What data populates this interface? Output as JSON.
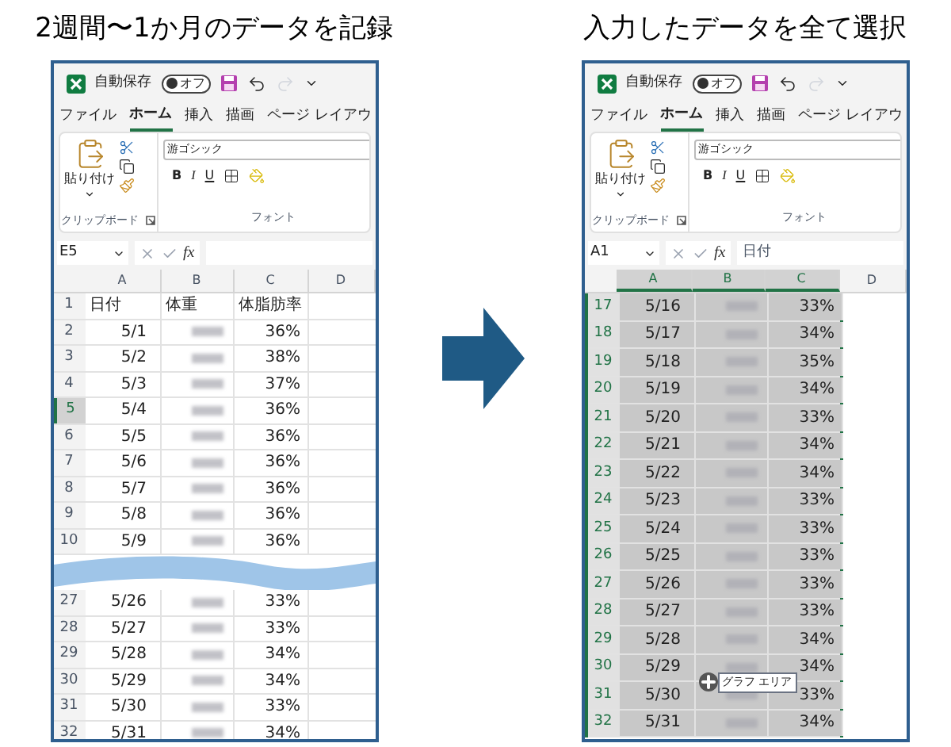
{
  "panels": [
    {
      "heading": "2週間〜1か月のデータを記録",
      "autosave_label": "自動保存",
      "autosave_on": false,
      "autosave_state": "オフ",
      "tabs": [
        {
          "label": "ファイル",
          "selected": false
        },
        {
          "label": "ホーム",
          "selected": true
        },
        {
          "label": "挿入",
          "selected": false
        },
        {
          "label": "描画",
          "selected": false
        },
        {
          "label": "ページ レイアウ",
          "selected": false
        }
      ],
      "paste_label": "貼り付け",
      "font_name": "游ゴシック",
      "format_buttons": [
        "B",
        "I",
        "U"
      ],
      "group_labels": [
        "クリップボード",
        "フォント"
      ],
      "name_box": "E5",
      "fx": "fx",
      "range_selected": false,
      "columns": [
        {
          "label": "A",
          "selected": false
        },
        {
          "label": "B",
          "selected": false
        },
        {
          "label": "C",
          "selected": false
        },
        {
          "label": "D",
          "selected": false
        }
      ],
      "row_groups": [
        {
          "rows": [
            {
              "kind": "header",
              "number": "1",
              "labels": [
                "日付",
                "体重",
                "体脂肪率"
              ],
              "selected": false
            },
            {
              "kind": "data",
              "number": "2",
              "date": "5/1",
              "percent": "36%",
              "selected": false
            },
            {
              "kind": "data",
              "number": "3",
              "date": "5/2",
              "percent": "38%",
              "selected": false
            },
            {
              "kind": "data",
              "number": "4",
              "date": "5/3",
              "percent": "37%",
              "selected": false
            },
            {
              "kind": "data",
              "number": "5",
              "date": "5/4",
              "percent": "36%",
              "selected": true
            },
            {
              "kind": "data",
              "number": "6",
              "date": "5/5",
              "percent": "36%",
              "selected": false
            },
            {
              "kind": "data",
              "number": "7",
              "date": "5/6",
              "percent": "36%",
              "selected": false
            },
            {
              "kind": "data",
              "number": "8",
              "date": "5/7",
              "percent": "36%",
              "selected": false
            },
            {
              "kind": "data",
              "number": "9",
              "date": "5/8",
              "percent": "36%",
              "selected": false
            },
            {
              "kind": "data",
              "number": "10",
              "date": "5/9",
              "percent": "36%",
              "selected": false
            }
          ]
        },
        {
          "rows": [
            {
              "kind": "data",
              "number": "27",
              "date": "5/26",
              "percent": "33%",
              "selected": false
            },
            {
              "kind": "data",
              "number": "28",
              "date": "5/27",
              "percent": "33%",
              "selected": false
            },
            {
              "kind": "data",
              "number": "29",
              "date": "5/28",
              "percent": "34%",
              "selected": false
            },
            {
              "kind": "data",
              "number": "30",
              "date": "5/29",
              "percent": "34%",
              "selected": false
            },
            {
              "kind": "data",
              "number": "31",
              "date": "5/30",
              "percent": "33%",
              "selected": false
            },
            {
              "kind": "data",
              "number": "32",
              "date": "5/31",
              "percent": "34%",
              "selected": false
            }
          ]
        }
      ]
    },
    {
      "heading": "入力したデータを全て選択",
      "autosave_label": "自動保存",
      "autosave_on": false,
      "autosave_state": "オフ",
      "tabs": [
        {
          "label": "ファイル",
          "selected": false
        },
        {
          "label": "ホーム",
          "selected": true
        },
        {
          "label": "挿入",
          "selected": false
        },
        {
          "label": "描画",
          "selected": false
        },
        {
          "label": "ページ レイアウ",
          "selected": false
        }
      ],
      "paste_label": "貼り付け",
      "font_name": "游ゴシック",
      "format_buttons": [
        "B",
        "I",
        "U"
      ],
      "group_labels": [
        "クリップボード",
        "フォント"
      ],
      "name_box": "A1",
      "fx": "fx",
      "formula": "日付",
      "range_selected": true,
      "tooltip": "グラフ エリア",
      "columns": [
        {
          "label": "A",
          "selected": true
        },
        {
          "label": "B",
          "selected": true
        },
        {
          "label": "C",
          "selected": true
        },
        {
          "label": "D",
          "selected": false
        }
      ],
      "row_groups": [
        {
          "rows": [
            {
              "kind": "data",
              "number": "17",
              "date": "5/16",
              "percent": "33%",
              "selected": true
            },
            {
              "kind": "data",
              "number": "18",
              "date": "5/17",
              "percent": "34%",
              "selected": true
            },
            {
              "kind": "data",
              "number": "19",
              "date": "5/18",
              "percent": "35%",
              "selected": true
            },
            {
              "kind": "data",
              "number": "20",
              "date": "5/19",
              "percent": "34%",
              "selected": true
            },
            {
              "kind": "data",
              "number": "21",
              "date": "5/20",
              "percent": "33%",
              "selected": true
            },
            {
              "kind": "data",
              "number": "22",
              "date": "5/21",
              "percent": "34%",
              "selected": true
            },
            {
              "kind": "data",
              "number": "23",
              "date": "5/22",
              "percent": "34%",
              "selected": true
            },
            {
              "kind": "data",
              "number": "24",
              "date": "5/23",
              "percent": "33%",
              "selected": true
            },
            {
              "kind": "data",
              "number": "25",
              "date": "5/24",
              "percent": "33%",
              "selected": true
            },
            {
              "kind": "data",
              "number": "26",
              "date": "5/25",
              "percent": "33%",
              "selected": true
            },
            {
              "kind": "data",
              "number": "27",
              "date": "5/26",
              "percent": "33%",
              "selected": true
            },
            {
              "kind": "data",
              "number": "28",
              "date": "5/27",
              "percent": "33%",
              "selected": true
            },
            {
              "kind": "data",
              "number": "29",
              "date": "5/28",
              "percent": "34%",
              "selected": true
            },
            {
              "kind": "data",
              "number": "30",
              "date": "5/29",
              "percent": "34%",
              "selected": true
            },
            {
              "kind": "data",
              "number": "31",
              "date": "5/30",
              "percent": "33%",
              "selected": true
            },
            {
              "kind": "data",
              "number": "32",
              "date": "5/31",
              "percent": "34%",
              "selected": true
            }
          ]
        }
      ]
    }
  ]
}
